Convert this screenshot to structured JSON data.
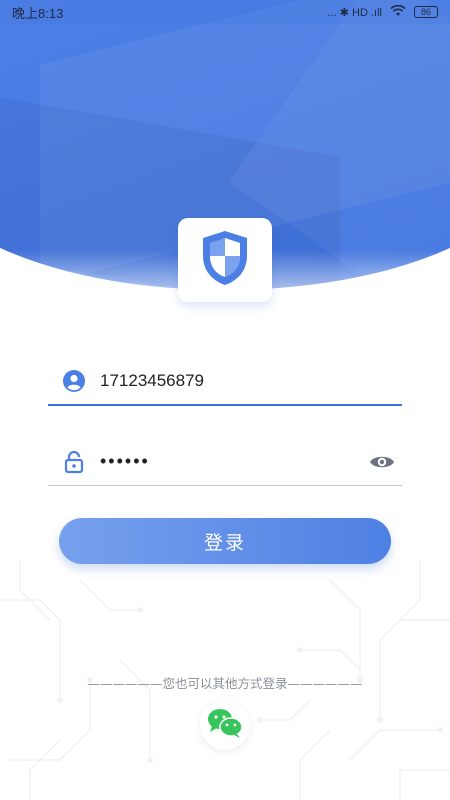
{
  "status_bar": {
    "time": "晚上8:13",
    "indicators": "... ✱ HD .ıll",
    "battery": "86"
  },
  "logo": {
    "icon": "shield-icon"
  },
  "form": {
    "phone": {
      "value": "17123456879",
      "icon": "user-circle-icon"
    },
    "password": {
      "value": "••••••",
      "icon": "lock-icon",
      "toggle_icon": "eye-icon"
    }
  },
  "login_button": {
    "label": "登录"
  },
  "alternate": {
    "label": "——————您也可以其他方式登录——————",
    "wechat_icon": "wechat-icon"
  },
  "colors": {
    "primary": "#4c7fe6",
    "accent_line": "#3c74dc",
    "wechat_green": "#36c55a"
  }
}
